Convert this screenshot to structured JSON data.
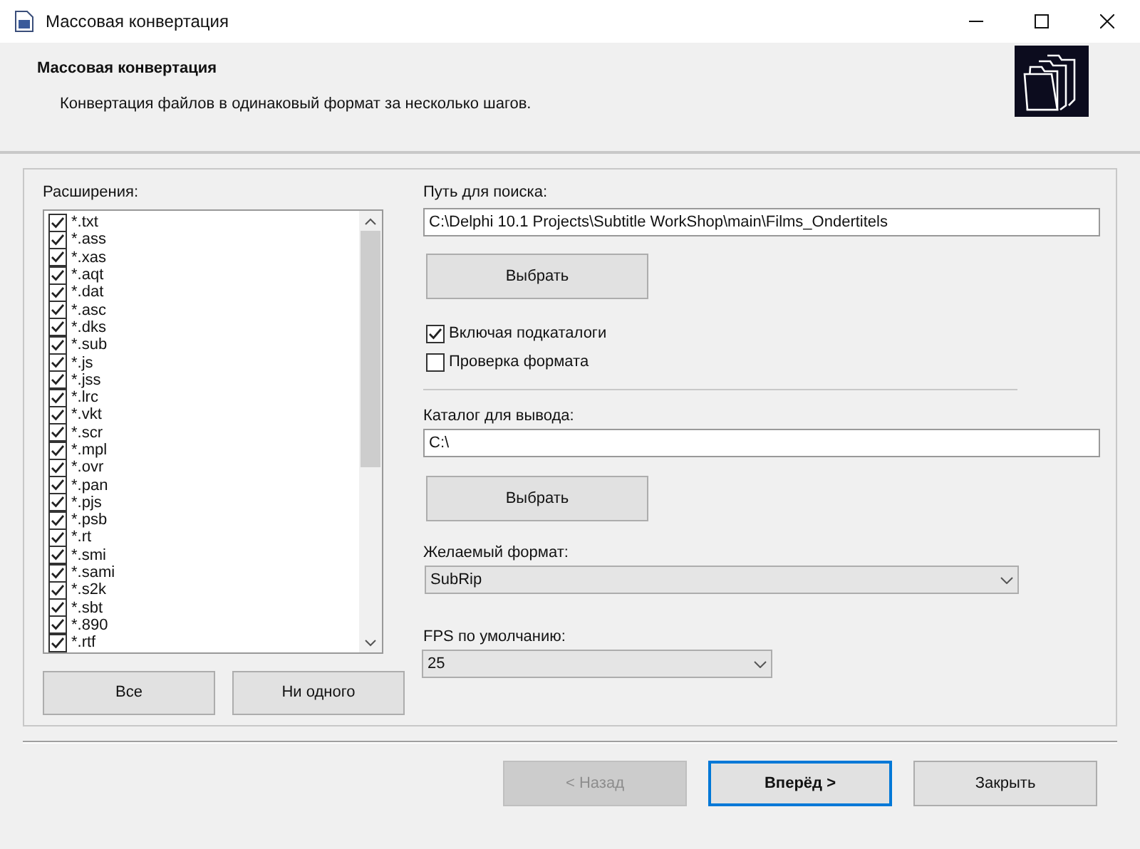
{
  "window": {
    "title": "Массовая конвертация"
  },
  "header": {
    "title": "Массовая конвертация",
    "subtitle": "Конвертация файлов в одинаковый формат за несколько шагов."
  },
  "extensions": {
    "label": "Расширения:",
    "items": [
      {
        "label": "*.txt",
        "checked": true
      },
      {
        "label": "*.ass",
        "checked": true
      },
      {
        "label": "*.xas",
        "checked": true
      },
      {
        "label": "*.aqt",
        "checked": true
      },
      {
        "label": "*.dat",
        "checked": true
      },
      {
        "label": "*.asc",
        "checked": true
      },
      {
        "label": "*.dks",
        "checked": true
      },
      {
        "label": "*.sub",
        "checked": true
      },
      {
        "label": "*.js",
        "checked": true
      },
      {
        "label": "*.jss",
        "checked": true
      },
      {
        "label": "*.lrc",
        "checked": true
      },
      {
        "label": "*.vkt",
        "checked": true
      },
      {
        "label": "*.scr",
        "checked": true
      },
      {
        "label": "*.mpl",
        "checked": true
      },
      {
        "label": "*.ovr",
        "checked": true
      },
      {
        "label": "*.pan",
        "checked": true
      },
      {
        "label": "*.pjs",
        "checked": true
      },
      {
        "label": "*.psb",
        "checked": true
      },
      {
        "label": "*.rt",
        "checked": true
      },
      {
        "label": "*.smi",
        "checked": true
      },
      {
        "label": "*.sami",
        "checked": true
      },
      {
        "label": "*.s2k",
        "checked": true
      },
      {
        "label": "*.sbt",
        "checked": true
      },
      {
        "label": "*.890",
        "checked": true
      },
      {
        "label": "*.rtf",
        "checked": true
      }
    ],
    "buttons": [
      "Все",
      "Ни одного"
    ]
  },
  "search_path": {
    "label": "Путь для поиска:",
    "value": "C:\\Delphi 10.1 Projects\\Subtitle WorkShop\\main\\Films_Ondertitels",
    "button": "Выбрать"
  },
  "options": [
    {
      "label": "Включая подкаталоги",
      "checked": true
    },
    {
      "label": "Проверка формата",
      "checked": false
    }
  ],
  "output_dir": {
    "label": "Каталог для вывода:",
    "value": "C:\\",
    "button": "Выбрать"
  },
  "format": {
    "label": "Желаемый формат:",
    "value": "SubRip"
  },
  "fps": {
    "label": "FPS по умолчанию:",
    "value": "25"
  },
  "footer_buttons": [
    {
      "label": "< Назад",
      "disabled": true,
      "default": false
    },
    {
      "label": "Вперёд >",
      "disabled": false,
      "default": true
    },
    {
      "label": "Закрыть",
      "disabled": false,
      "default": false
    }
  ]
}
